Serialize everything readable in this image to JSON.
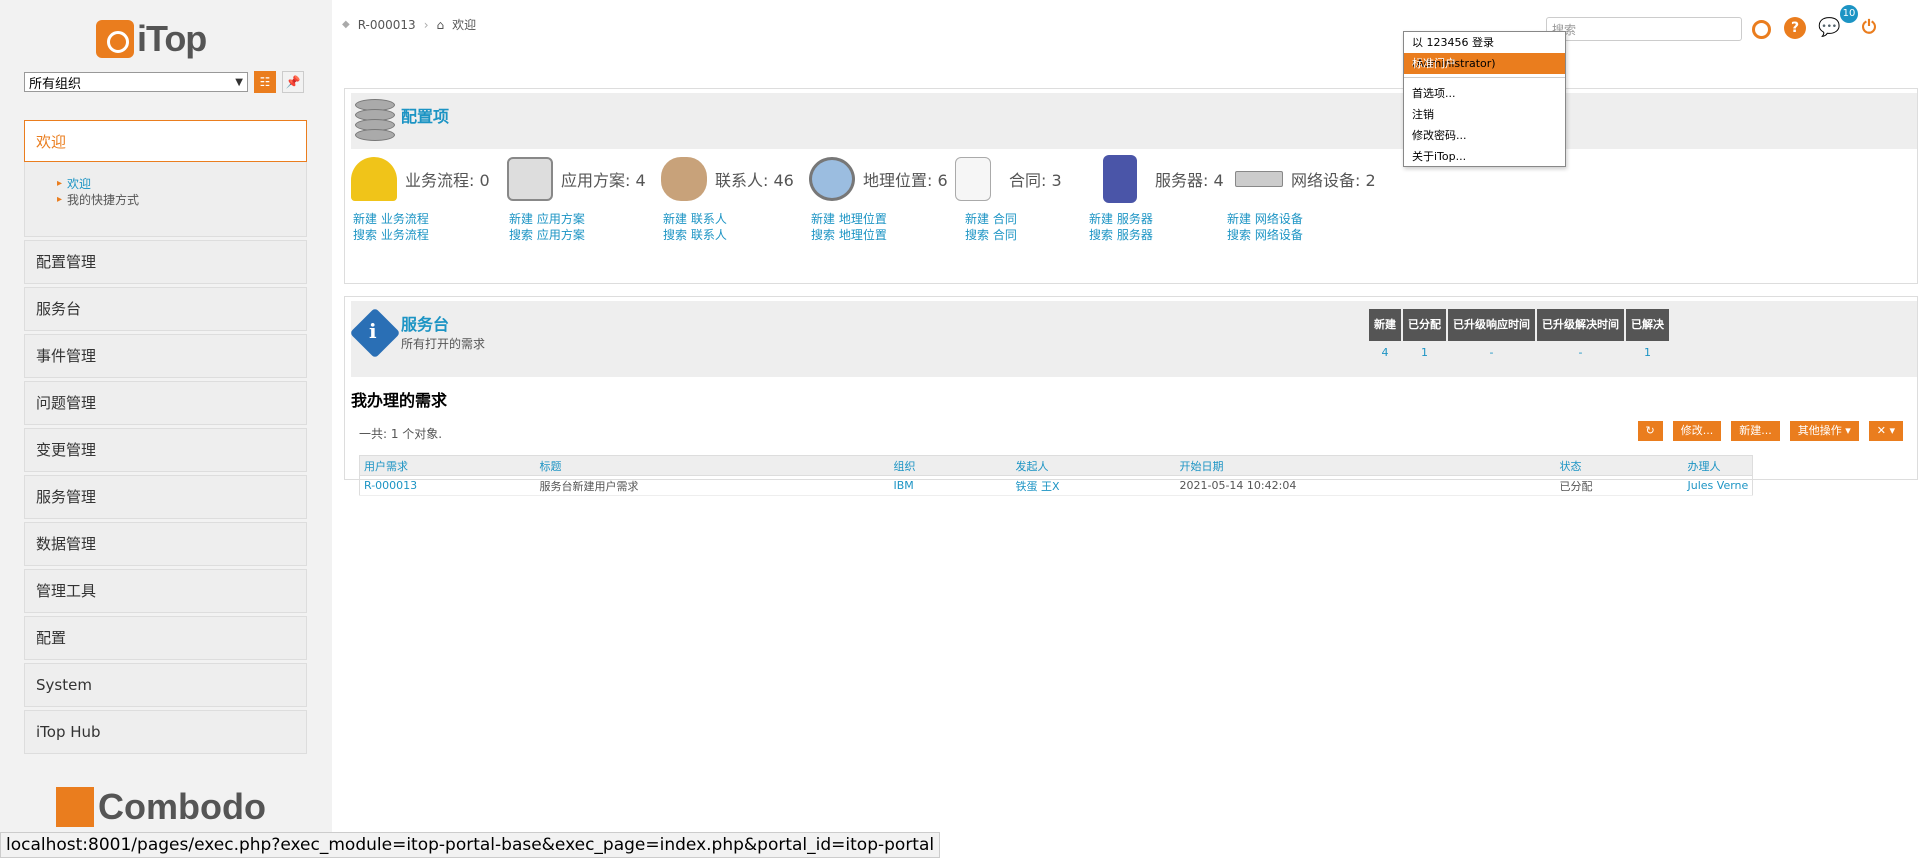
{
  "brand": {
    "logo_text": "iTop",
    "footer_logo_text": "Combodo"
  },
  "org_selector": {
    "value": "所有组织"
  },
  "menu": {
    "active": "欢迎",
    "active_items": [
      "欢迎",
      "我的快捷方式"
    ],
    "groups": [
      "配置管理",
      "服务台",
      "事件管理",
      "问题管理",
      "变更管理",
      "服务管理",
      "数据管理",
      "管理工具",
      "配置",
      "System",
      "iTop Hub"
    ]
  },
  "breadcrumb": {
    "item1": "R-000013",
    "item2": "欢迎"
  },
  "search": {
    "placeholder": "搜索"
  },
  "notifications": {
    "count": "10"
  },
  "user_menu": {
    "login": "以 123456 登录(Administrator)",
    "portal": "标准门户",
    "prefs": "首选项...",
    "logout": "注销",
    "change_pwd": "修改密码...",
    "about": "关于iTop..."
  },
  "ci_dashlet": {
    "title": "配置项",
    "items": [
      {
        "label": "业务流程: 0",
        "new": "新建 业务流程",
        "search": "搜索 业务流程"
      },
      {
        "label": "应用方案: 4",
        "new": "新建 应用方案",
        "search": "搜索 应用方案"
      },
      {
        "label": "联系人: 46",
        "new": "新建 联系人",
        "search": "搜索 联系人"
      },
      {
        "label": "地理位置: 6",
        "new": "新建 地理位置",
        "search": "搜索 地理位置"
      },
      {
        "label": "合同: 3",
        "new": "新建 合同",
        "search": "搜索 合同"
      },
      {
        "label": "服务器: 4",
        "new": "新建 服务器",
        "search": "搜索 服务器"
      },
      {
        "label": "网络设备: 2",
        "new": "新建 网络设备",
        "search": "搜索 网络设备"
      }
    ]
  },
  "sd_dashlet": {
    "title": "服务台",
    "subtitle": "所有打开的需求",
    "stats": [
      {
        "head": "新建",
        "val": "4"
      },
      {
        "head": "已分配",
        "val": "1"
      },
      {
        "head": "已升级响应时间",
        "val": "-"
      },
      {
        "head": "已升级解决时间",
        "val": "-"
      },
      {
        "head": "已解决",
        "val": "1"
      }
    ]
  },
  "my_requests": {
    "title": "我办理的需求",
    "count": "一共: 1 个对象.",
    "buttons": {
      "refresh": "↻",
      "modify": "修改...",
      "new": "新建...",
      "other": "其他操作 ▾",
      "tools": "✕ ▾"
    },
    "columns": [
      "用户需求",
      "标题",
      "组织",
      "发起人",
      "开始日期",
      "状态",
      "办理人"
    ],
    "rows": [
      [
        "R-000013",
        "服务台新建用户需求",
        "IBM",
        "铁蛋 王X",
        "2021-05-14 10:42:04",
        "已分配",
        "Jules Verne"
      ]
    ]
  },
  "status_bar": {
    "url": "localhost:8001/pages/exec.php?exec_module=itop-portal-base&exec_page=index.php&portal_id=itop-portal"
  },
  "colors": {
    "accent": "#ea7d1e",
    "link": "#1c94c4"
  }
}
